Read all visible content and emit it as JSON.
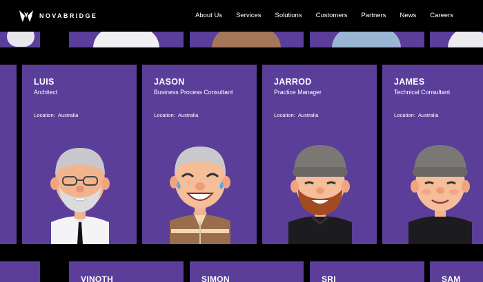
{
  "brand": {
    "name": "NOVABRIDGE"
  },
  "nav": [
    "About Us",
    "Services",
    "Solutions",
    "Customers",
    "Partners",
    "News",
    "Careers"
  ],
  "location_label": "Location:",
  "people": [
    {
      "name": "LUIS",
      "role": "Architect",
      "location": "Australia",
      "icon": "avatar-grey-beard-glasses"
    },
    {
      "name": "JASON",
      "role": "Business Process Consultant",
      "location": "Australia",
      "icon": "avatar-laughing-grey-hair"
    },
    {
      "name": "JARROD",
      "role": "Practice Manager",
      "location": "Australia",
      "icon": "avatar-beanie-red-beard"
    },
    {
      "name": "JAMES",
      "role": "Technical Consultant",
      "location": "Australia",
      "icon": "avatar-beanie-smiling"
    }
  ],
  "next_people": [
    "VINOTH",
    "SIMON",
    "SRI",
    "SAM"
  ],
  "colors": {
    "card": "#5a3e9a",
    "background": "#000000"
  }
}
